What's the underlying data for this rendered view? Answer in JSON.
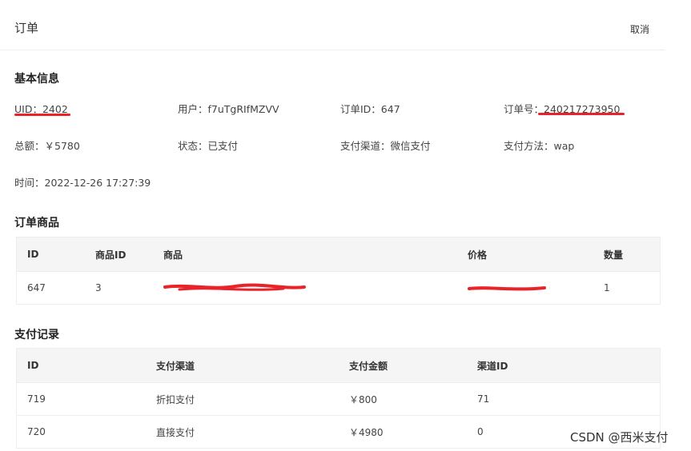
{
  "header": {
    "title": "订单",
    "cancel_label": "取消"
  },
  "basic_info": {
    "section_title": "基本信息",
    "uid": "UID：2402",
    "user": "用户：f7uTgRIfMZVV",
    "order_id": "订单ID：647",
    "order_no": "订单号：240217273950",
    "total": "总额：￥5780",
    "status": "状态：已支付",
    "channel": "支付渠道：微信支付",
    "method": "支付方法：wap",
    "time": "时间：2022-12-26 17:27:39"
  },
  "order_items": {
    "section_title": "订单商品",
    "columns": [
      "ID",
      "商品ID",
      "商品",
      "价格",
      "数量"
    ],
    "rows": [
      {
        "id": "647",
        "product_id": "3",
        "product": "",
        "price": "",
        "quantity": "1"
      }
    ]
  },
  "payments": {
    "section_title": "支付记录",
    "columns": [
      "ID",
      "支付渠道",
      "支付金额",
      "渠道ID"
    ],
    "rows": [
      {
        "id": "719",
        "channel": "折扣支付",
        "amount": "￥800",
        "channel_id": "71"
      },
      {
        "id": "720",
        "channel": "直接支付",
        "amount": "￥4980",
        "channel_id": "0"
      }
    ]
  },
  "watermark": "CSDN @西米支付",
  "colors": {
    "redaction": "#e8232a",
    "header_bg": "#f5f5f5"
  }
}
